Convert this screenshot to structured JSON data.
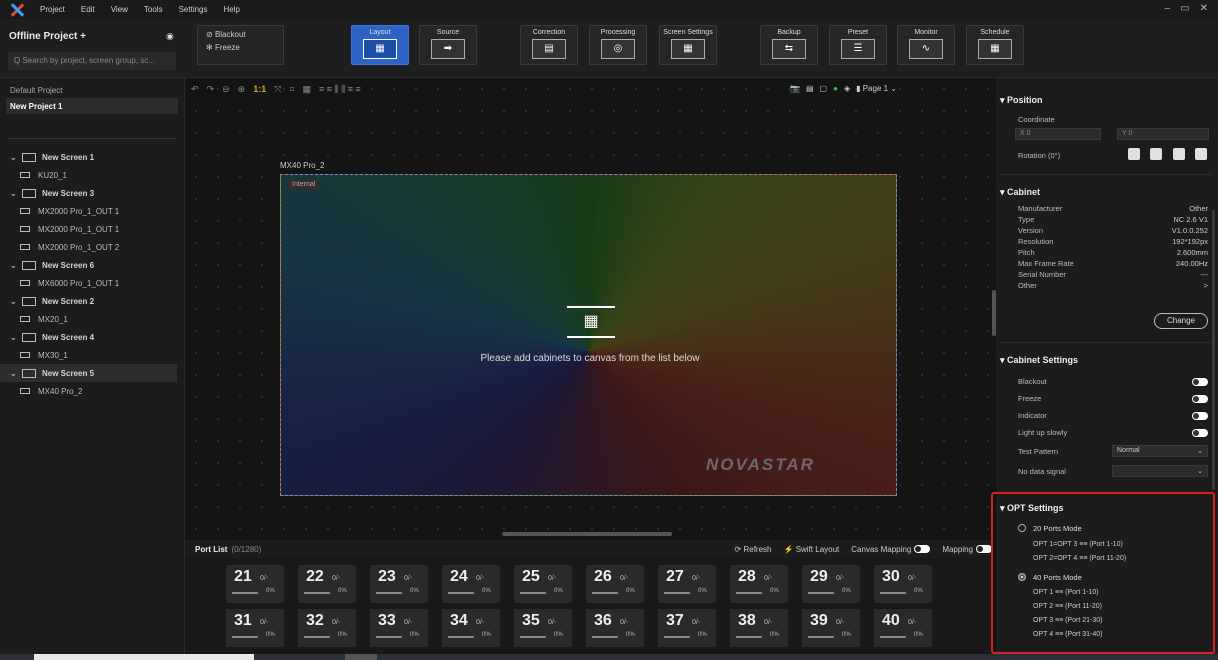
{
  "menu": {
    "items": [
      "Project",
      "Edit",
      "View",
      "Tools",
      "Settings",
      "Help"
    ],
    "window_controls": [
      "–",
      "▭",
      "✕"
    ]
  },
  "left": {
    "header": "Offline Project +",
    "search_placeholder": "Q  Search by project, screen group, sc...",
    "projects": [
      "Default Project",
      "New Project 1"
    ],
    "tree": [
      {
        "type": "screen",
        "label": "New Screen 1"
      },
      {
        "type": "recv",
        "label": "KU20_1"
      },
      {
        "type": "screen",
        "label": "New Screen 3"
      },
      {
        "type": "recv",
        "label": "MX2000 Pro_1_OUT 1"
      },
      {
        "type": "recv",
        "label": "MX2000 Pro_1_OUT 1"
      },
      {
        "type": "recv",
        "label": "MX2000 Pro_1_OUT 2"
      },
      {
        "type": "screen",
        "label": "New Screen 6"
      },
      {
        "type": "recv",
        "label": "MX6000 Pro_1_OUT 1"
      },
      {
        "type": "screen",
        "label": "New Screen 2"
      },
      {
        "type": "recv",
        "label": "MX20_1"
      },
      {
        "type": "screen",
        "label": "New Screen 4"
      },
      {
        "type": "recv",
        "label": "MX30_1"
      },
      {
        "type": "screen",
        "label": "New Screen 5",
        "selected": true
      },
      {
        "type": "recv",
        "label": "MX40 Pro_2"
      }
    ]
  },
  "toolbar": {
    "blackout": "Blackout",
    "freeze": "Freeze",
    "buttons": [
      "Layout",
      "Source",
      "Correction",
      "Processing",
      "Screen Settings",
      "Backup",
      "Preset",
      "Monitor",
      "Schedule"
    ],
    "active": "Layout"
  },
  "canvas": {
    "screen_label": "MX40 Pro_2",
    "tag": "Internal",
    "hint": "Please add cabinets to canvas from the list below",
    "watermark": "NOVASTAR",
    "zoom_11": "1:1",
    "page": "Page 1"
  },
  "portlist": {
    "title": "Port List",
    "count": "(0/1280)",
    "refresh": "Refresh",
    "swift": "Swift Layout",
    "canvas_mapping": "Canvas Mapping",
    "mapping": "Mapping",
    "ports": [
      {
        "n": "21",
        "f": "0/-",
        "p": "0%"
      },
      {
        "n": "22",
        "f": "0/-",
        "p": "0%"
      },
      {
        "n": "23",
        "f": "0/-",
        "p": "0%"
      },
      {
        "n": "24",
        "f": "0/-",
        "p": "0%"
      },
      {
        "n": "25",
        "f": "0/-",
        "p": "0%"
      },
      {
        "n": "26",
        "f": "0/-",
        "p": "0%"
      },
      {
        "n": "27",
        "f": "0/-",
        "p": "0%"
      },
      {
        "n": "28",
        "f": "0/-",
        "p": "0%"
      },
      {
        "n": "29",
        "f": "0/-",
        "p": "0%"
      },
      {
        "n": "30",
        "f": "0/-",
        "p": "0%"
      },
      {
        "n": "31",
        "f": "0/-",
        "p": "0%"
      },
      {
        "n": "32",
        "f": "0/-",
        "p": "0%"
      },
      {
        "n": "33",
        "f": "0/-",
        "p": "0%"
      },
      {
        "n": "34",
        "f": "0/-",
        "p": "0%"
      },
      {
        "n": "35",
        "f": "0/-",
        "p": "0%"
      },
      {
        "n": "36",
        "f": "0/-",
        "p": "0%"
      },
      {
        "n": "37",
        "f": "0/-",
        "p": "0%"
      },
      {
        "n": "38",
        "f": "0/-",
        "p": "0%"
      },
      {
        "n": "39",
        "f": "0/-",
        "p": "0%"
      },
      {
        "n": "40",
        "f": "0/-",
        "p": "0%"
      }
    ]
  },
  "right": {
    "position": {
      "title": "Position",
      "coordinate": "Coordinate",
      "x_label": "X",
      "x": "0",
      "y_label": "Y",
      "y": "0",
      "rotation": "Rotation (0°)"
    },
    "cabinet": {
      "title": "Cabinet",
      "rows": [
        [
          "Manufacturer",
          "Other"
        ],
        [
          "Type",
          "NC 2.6 V1"
        ],
        [
          "Version",
          "V1.0.0.252"
        ],
        [
          "Resolution",
          "192*192px"
        ],
        [
          "Pitch",
          "2.600mm"
        ],
        [
          "Max Frame Rate",
          "240.00Hz"
        ],
        [
          "Serial Number",
          "---"
        ],
        [
          "Other",
          ">"
        ]
      ],
      "change": "Change"
    },
    "cabinet_settings": {
      "title": "Cabinet Settings",
      "blackout": "Blackout",
      "freeze": "Freeze",
      "indicator": "Indicator",
      "light": "Light up slowly",
      "test_pattern": "Test Pattern",
      "test_value": "Normal",
      "no_signal": "No data signal"
    },
    "opt": {
      "title": "OPT Settings",
      "mode20": "20 Ports Mode",
      "m20_lines": [
        "OPT 1=OPT 3  ≡≡  (Port 1-10)",
        "OPT 2=OPT 4  ≡≡  (Port 11-20)"
      ],
      "mode40": "40 Ports Mode",
      "m40_lines": [
        "OPT 1  ≡≡  (Port 1-10)",
        "OPT 2  ≡≡  (Port 11-20)",
        "OPT 3  ≡≡  (Port 21-30)",
        "OPT 4  ≡≡  (Port 31-40)"
      ],
      "selected": "40 Ports Mode"
    }
  }
}
